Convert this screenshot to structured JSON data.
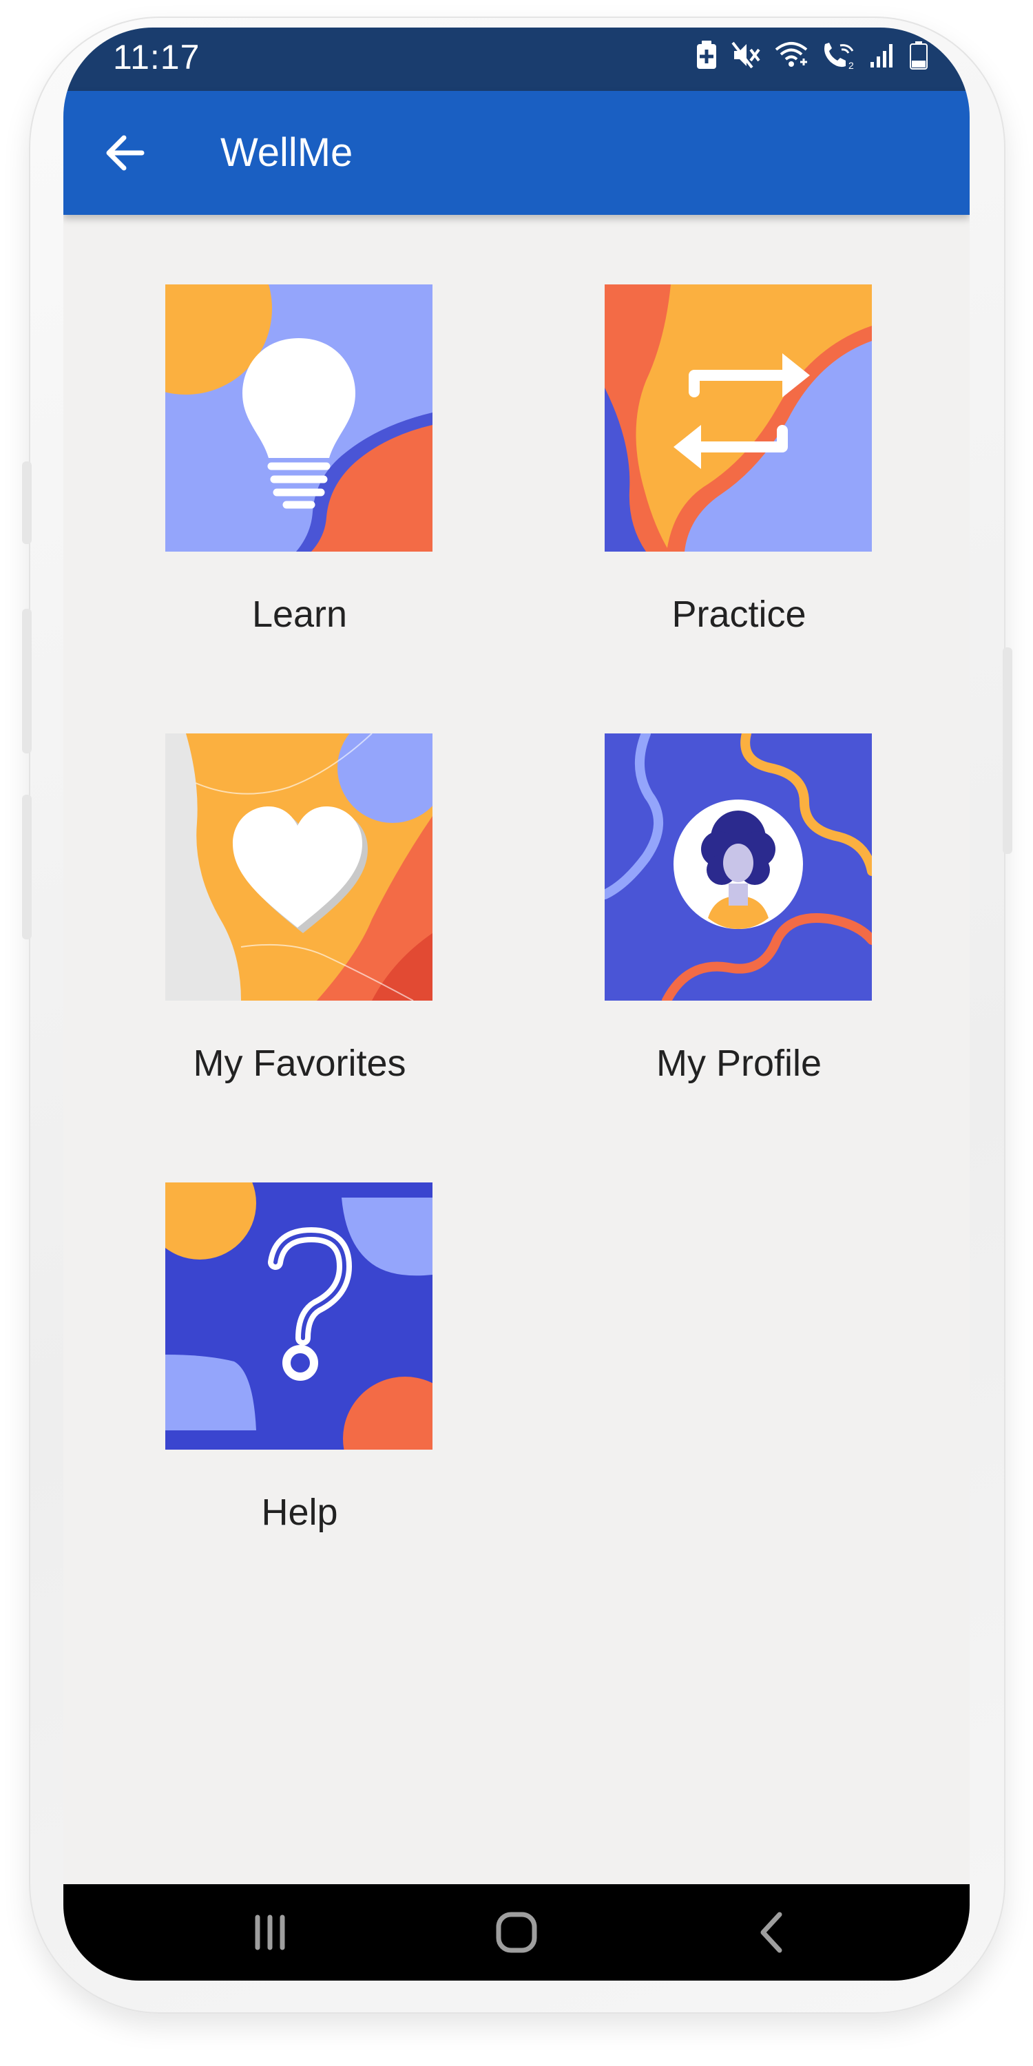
{
  "status_bar": {
    "time": "11:17",
    "icons": [
      "battery-saver-icon",
      "mute-icon",
      "wifi-calling-icon",
      "vowifi-icon",
      "signal-icon",
      "battery-icon"
    ]
  },
  "app_bar": {
    "title": "WellMe",
    "back_icon": "arrow-left-icon"
  },
  "tiles": [
    {
      "label": "Learn",
      "icon": "lightbulb-icon"
    },
    {
      "label": "Practice",
      "icon": "repeat-arrows-icon"
    },
    {
      "label": "My Favorites",
      "icon": "heart-icon"
    },
    {
      "label": "My Profile",
      "icon": "avatar-icon"
    },
    {
      "label": "Help",
      "icon": "question-mark-icon"
    }
  ],
  "nav_bar": {
    "buttons": [
      "recents-icon",
      "home-icon",
      "back-icon"
    ]
  },
  "colors": {
    "status_bar": "#1a3d6e",
    "app_bar": "#1a5fc2",
    "background": "#f2f1f0",
    "orange": "#fbb040",
    "red_orange": "#f36b46",
    "periwinkle": "#94a5fb",
    "indigo": "#3a45cf"
  }
}
